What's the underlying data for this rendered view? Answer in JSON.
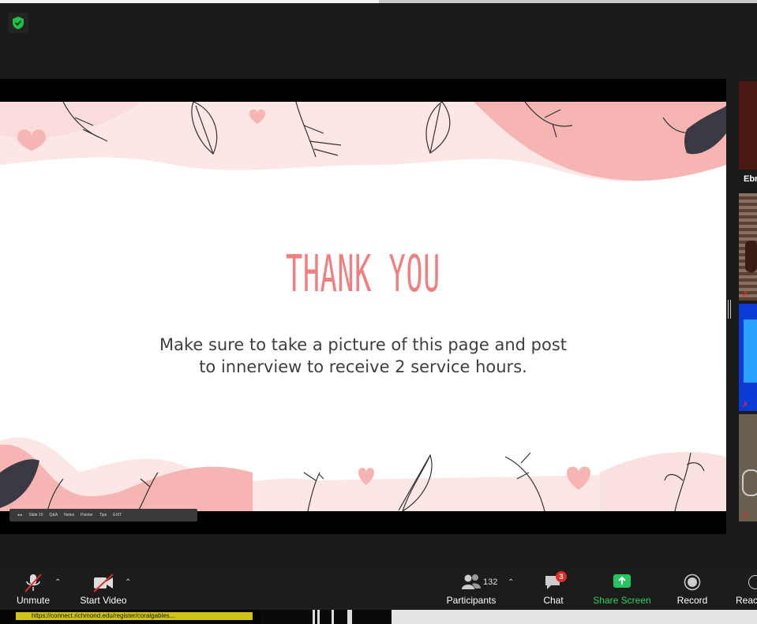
{
  "slide": {
    "title": "THANK YOU",
    "body_line1": "Make sure to take a picture of this page and post",
    "body_line2": "to innerview to receive 2 service hours."
  },
  "presenter_toolbar": {
    "slide_label": "Slide 10",
    "items": [
      "Q&A",
      "Notes",
      "Pointer",
      "Tips",
      "EXIT"
    ]
  },
  "participants_strip": {
    "tile1_name": "Ebr"
  },
  "controls": {
    "unmute": "Unmute",
    "start_video": "Start Video",
    "participants": "Participants",
    "participants_count": "132",
    "chat": "Chat",
    "chat_badge": "3",
    "share_screen": "Share Screen",
    "record": "Record",
    "reactions": "Reac"
  },
  "status_url": "https://connect.richmond.edu/register/coralgables...",
  "colors": {
    "share_green": "#22c55e",
    "slide_pink": "#f4a5a5",
    "title_coral": "#f08080",
    "badge_red": "#e02b2b"
  }
}
